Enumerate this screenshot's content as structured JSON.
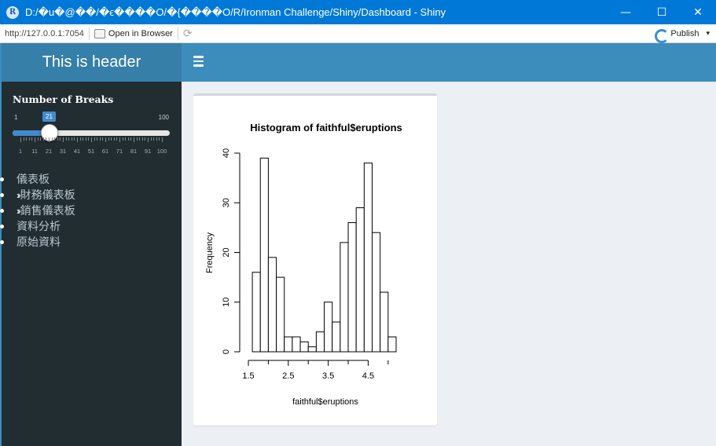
{
  "window": {
    "title": "D:/�u�@��/�ϵ����O/�{����O/R/Ironman Challenge/Shiny/Dashboard - Shiny",
    "app_icon": "R",
    "minimize": "—",
    "maximize": "☐",
    "close": "✕"
  },
  "toolbar": {
    "url": "http://127.0.0.1:7054",
    "open_browser": "Open in Browser",
    "publish": "Publish",
    "publish_arrow": "▾"
  },
  "header": {
    "title": "This is header"
  },
  "sidebar": {
    "slider": {
      "label": "Number of Breaks",
      "min": "1",
      "max": "100",
      "value": "21",
      "value_fraction": 0.2,
      "grid_labels": [
        "1",
        "11",
        "21",
        "31",
        "41",
        "51",
        "61",
        "71",
        "81",
        "91",
        "100"
      ]
    },
    "menu": [
      {
        "label": "儀表板",
        "has_chevron": false
      },
      {
        "label": "財務儀表板",
        "has_chevron": true
      },
      {
        "label": "銷售儀表板",
        "has_chevron": true
      },
      {
        "label": "資料分析",
        "has_chevron": false
      },
      {
        "label": "原始資料",
        "has_chevron": false
      }
    ],
    "chevron_icon": "»"
  },
  "chart_data": {
    "type": "bar",
    "title": "Histogram of faithful$eruptions",
    "xlabel": "faithful$eruptions",
    "ylabel": "Frequency",
    "bin_edges": [
      1.6,
      1.8,
      2.0,
      2.2,
      2.4,
      2.6,
      2.8,
      3.0,
      3.2,
      3.4,
      3.6,
      3.8,
      4.0,
      4.2,
      4.4,
      4.6,
      4.8,
      5.0,
      5.2
    ],
    "values": [
      16,
      39,
      19,
      15,
      3,
      3,
      2,
      1,
      4,
      10,
      6,
      22,
      26,
      29,
      38,
      24,
      12,
      3
    ],
    "x_ticks": [
      "1.5",
      "2.5",
      "3.5",
      "4.5"
    ],
    "x_tick_values": [
      1.5,
      2.5,
      3.5,
      4.5
    ],
    "y_ticks": [
      "0",
      "10",
      "20",
      "30",
      "40"
    ],
    "y_tick_values": [
      0,
      10,
      20,
      30,
      40
    ],
    "xlim": [
      1.5,
      5.2
    ],
    "ylim": [
      0,
      40
    ],
    "colors": {
      "bar_fill": "#ffffff",
      "bar_stroke": "#000000"
    }
  }
}
